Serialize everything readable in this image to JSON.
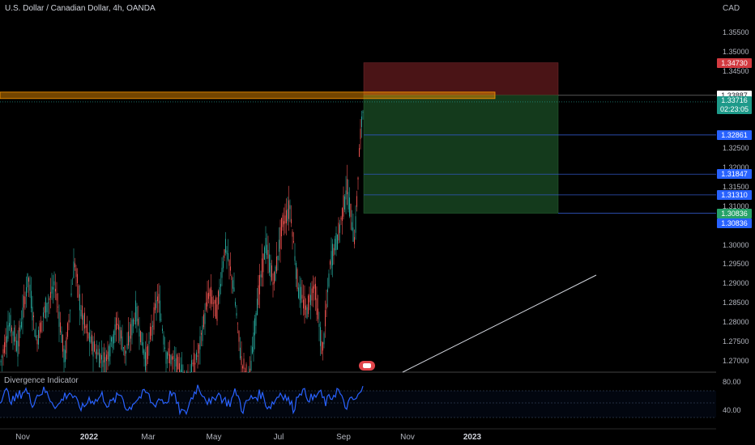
{
  "header": {
    "title": "U.S. Dollar / Canadian Dollar, 4h, OANDA",
    "currency": "CAD"
  },
  "indicator": {
    "name": "Divergence Indicator",
    "ticks": [
      "80.00",
      "40.00"
    ]
  },
  "price_axis": {
    "ticks": [
      "1.35500",
      "1.35000",
      "1.34500",
      "1.33500",
      "1.32500",
      "1.32000",
      "1.31500",
      "1.31000",
      "1.30000",
      "1.29500",
      "1.29000",
      "1.28500",
      "1.28000",
      "1.27500",
      "1.27000"
    ],
    "tags": [
      {
        "value": "1.34730",
        "style": "red"
      },
      {
        "value": "1.33887",
        "style": "white"
      },
      {
        "value": "1.33716",
        "countdown": "02:23:05",
        "style": "teal"
      },
      {
        "value": "1.32861",
        "style": "blue"
      },
      {
        "value": "1.31847",
        "style": "blue"
      },
      {
        "value": "1.31310",
        "style": "blue"
      },
      {
        "value": "1.30836",
        "style": "green"
      },
      {
        "value": "1.30836",
        "style": "blue"
      }
    ]
  },
  "time_axis": {
    "labels": [
      {
        "text": "Nov",
        "bold": false
      },
      {
        "text": "2022",
        "bold": true
      },
      {
        "text": "Mar",
        "bold": false
      },
      {
        "text": "May",
        "bold": false
      },
      {
        "text": "Jul",
        "bold": false
      },
      {
        "text": "Sep",
        "bold": false
      },
      {
        "text": "Nov",
        "bold": false
      },
      {
        "text": "2023",
        "bold": true
      }
    ]
  },
  "position": {
    "type": "short",
    "entry": 1.33887,
    "stop": 1.3473,
    "target": 1.30836,
    "current": 1.33716,
    "levels": [
      1.32861,
      1.31847,
      1.3131
    ]
  },
  "resistance_zone": {
    "top": 1.3397,
    "bottom": 1.3388
  },
  "colors": {
    "background": "#000000",
    "up_candle": "#26a69a",
    "down_candle": "#ef5350",
    "oscillator": "#2962ff",
    "stop_zone": "#4a1416",
    "target_zone": "#143a1c",
    "resistance": "#ff9800"
  },
  "chart_data": {
    "type": "candlestick",
    "symbol": "USDCAD",
    "ylim": [
      1.2685,
      1.3585
    ],
    "price_series": [
      [
        0,
        1.269
      ],
      [
        12,
        1.28
      ],
      [
        22,
        1.274
      ],
      [
        35,
        1.292
      ],
      [
        45,
        1.275
      ],
      [
        55,
        1.283
      ],
      [
        68,
        1.29
      ],
      [
        80,
        1.27
      ],
      [
        92,
        1.296
      ],
      [
        100,
        1.283
      ],
      [
        110,
        1.276
      ],
      [
        120,
        1.272
      ],
      [
        130,
        1.27
      ],
      [
        145,
        1.28
      ],
      [
        155,
        1.272
      ],
      [
        168,
        1.283
      ],
      [
        180,
        1.27
      ],
      [
        195,
        1.287
      ],
      [
        205,
        1.272
      ],
      [
        215,
        1.27
      ],
      [
        230,
        1.265
      ],
      [
        245,
        1.272
      ],
      [
        258,
        1.288
      ],
      [
        268,
        1.283
      ],
      [
        278,
        1.3
      ],
      [
        288,
        1.29
      ],
      [
        298,
        1.27
      ],
      [
        308,
        1.265
      ],
      [
        318,
        1.286
      ],
      [
        328,
        1.3
      ],
      [
        338,
        1.29
      ],
      [
        348,
        1.305
      ],
      [
        358,
        1.31
      ],
      [
        368,
        1.289
      ],
      [
        378,
        1.283
      ],
      [
        388,
        1.29
      ],
      [
        398,
        1.272
      ],
      [
        408,
        1.296
      ],
      [
        418,
        1.303
      ],
      [
        428,
        1.315
      ],
      [
        438,
        1.301
      ],
      [
        444,
        1.326
      ],
      [
        449,
        1.337
      ]
    ],
    "oscillator_series": [
      62,
      70,
      58,
      66,
      74,
      55,
      68,
      72,
      60,
      50,
      64,
      70,
      56,
      48,
      62,
      58,
      66,
      52,
      60,
      68,
      45,
      58,
      64,
      70,
      52,
      62,
      56,
      72,
      48,
      40,
      62,
      78,
      66,
      52,
      70,
      60,
      55,
      72,
      46,
      60,
      64,
      68,
      50,
      58,
      70,
      62,
      48,
      74,
      66,
      60,
      70,
      56,
      64,
      74,
      50,
      58,
      62,
      76
    ]
  }
}
